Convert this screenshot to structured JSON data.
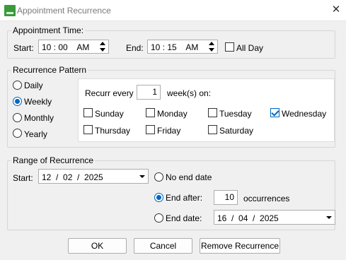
{
  "window": {
    "title": "Appointment Recurrence",
    "close_glyph": "✕"
  },
  "appointment_time": {
    "legend": "Appointment Time:",
    "start_label": "Start:",
    "start_value": "10 : 00    AM",
    "end_label": "End:",
    "end_value": "10 : 15    AM",
    "all_day_label": "All Day",
    "all_day_checked": false
  },
  "pattern": {
    "legend": "Recurrence Pattern",
    "options": [
      {
        "label": "Daily",
        "selected": false
      },
      {
        "label": "Weekly",
        "selected": true
      },
      {
        "label": "Monthly",
        "selected": false
      },
      {
        "label": "Yearly",
        "selected": false
      }
    ],
    "recur_every_label": "Recurr every",
    "recur_every_value": "1",
    "weeks_on_label": "week(s) on:",
    "days": [
      {
        "label": "Sunday",
        "checked": false
      },
      {
        "label": "Monday",
        "checked": false
      },
      {
        "label": "Tuesday",
        "checked": false
      },
      {
        "label": "Wednesday",
        "checked": true
      },
      {
        "label": "Thursday",
        "checked": false
      },
      {
        "label": "Friday",
        "checked": false
      },
      {
        "label": "Saturday",
        "checked": false
      }
    ]
  },
  "range": {
    "legend": "Range of Recurrence",
    "start_label": "Start:",
    "start_value": "12  /  02  /  2025",
    "no_end_label": "No end date",
    "end_after_label": "End after:",
    "end_after_value": "10",
    "occurrences_label": "occurrences",
    "end_date_label": "End date:",
    "end_date_value": "16  /  04  /  2025",
    "selected": "end_after"
  },
  "buttons": {
    "ok": "OK",
    "cancel": "Cancel",
    "remove": "Remove Recurrence"
  },
  "colors": {
    "accent": "#0067c0",
    "app_icon": "#3a9a3a"
  }
}
